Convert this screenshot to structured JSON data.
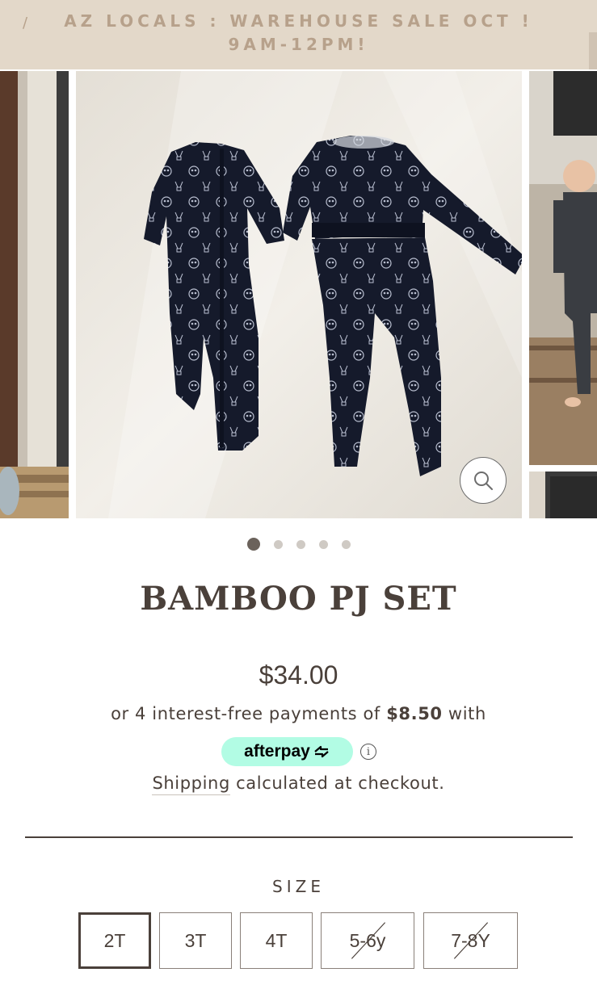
{
  "announcement": {
    "line1": "AZ LOCALS : WAREHOUSE SALE OCT !",
    "line2": "9AM-12PM!"
  },
  "gallery": {
    "slides": [
      {
        "name": "left-preview",
        "icon": "product-photo"
      },
      {
        "name": "main-photo",
        "icon": "product-photo"
      },
      {
        "name": "right-preview",
        "icon": "product-photo"
      }
    ],
    "zoom_icon": "magnifier-icon",
    "dot_count": 5,
    "active_dot": 0
  },
  "product": {
    "title": "BAMBOO PJ SET",
    "price": "$34.00",
    "installments_prefix": "or 4 interest-free payments of",
    "installments_amount": "$8.50",
    "installments_suffix": "with",
    "afterpay_label": "afterpay",
    "info_glyph": "i",
    "shipping_link": "Shipping",
    "shipping_rest": " calculated at checkout."
  },
  "options": {
    "size_label": "SIZE",
    "sizes": [
      {
        "label": "2T",
        "selected": true,
        "sold_out": false
      },
      {
        "label": "3T",
        "selected": false,
        "sold_out": false
      },
      {
        "label": "4T",
        "selected": false,
        "sold_out": false
      },
      {
        "label": "5-6y",
        "selected": false,
        "sold_out": true
      },
      {
        "label": "7-8Y",
        "selected": false,
        "sold_out": true
      }
    ]
  },
  "colors": {
    "announcement_bg": "#e3d8c9",
    "announcement_text": "#b7a18b",
    "text": "#4a403a",
    "afterpay_mint": "#b2fce4"
  }
}
